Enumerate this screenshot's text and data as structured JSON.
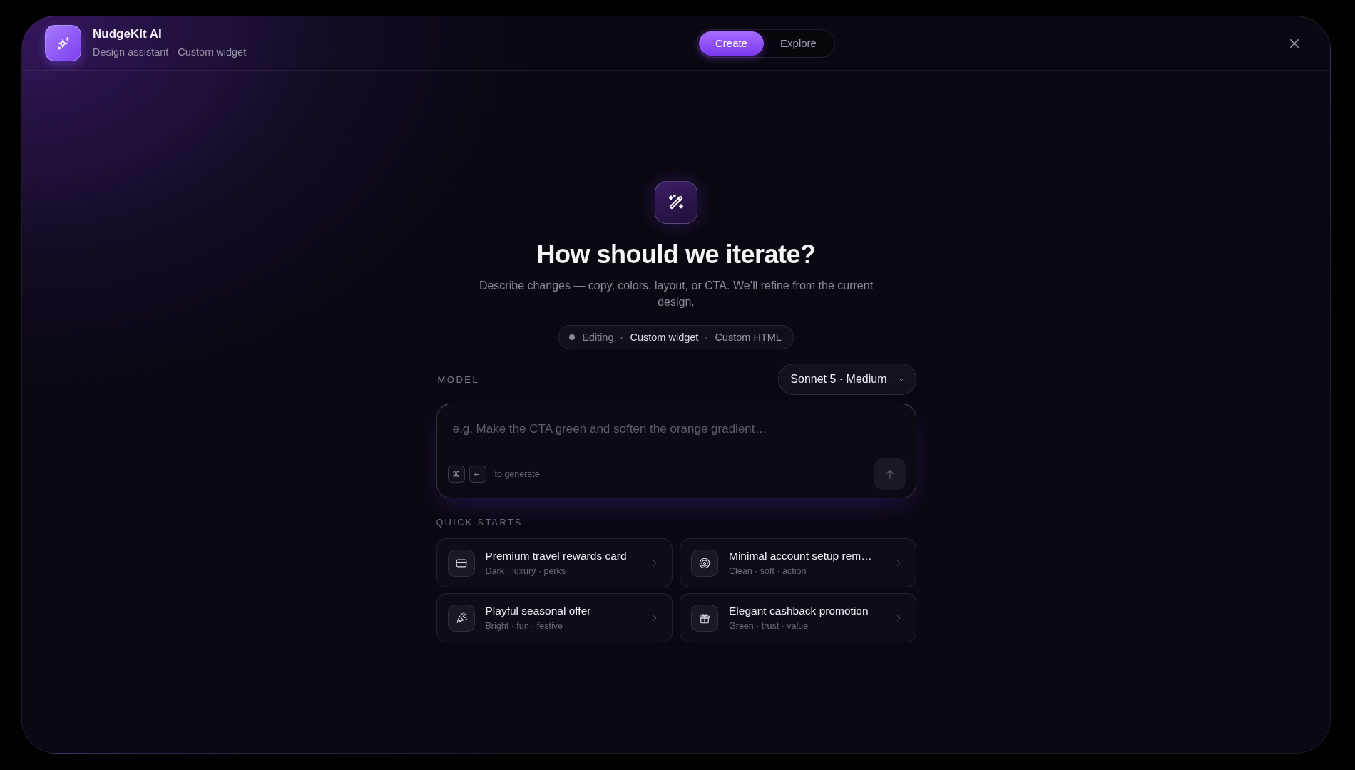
{
  "header": {
    "brand": {
      "title": "NudgeKit AI",
      "subtitle": "Design assistant · Custom widget"
    },
    "tabs": [
      {
        "label": "Create",
        "selected": true
      },
      {
        "label": "Explore",
        "selected": false
      }
    ]
  },
  "hero": {
    "title": "How should we iterate?",
    "description": "Describe changes — copy, colors, layout, or CTA. We’ll refine from the current design."
  },
  "context_chip": {
    "status": "Editing",
    "widget": "Custom widget",
    "format": "Custom HTML"
  },
  "model": {
    "label": "MODEL",
    "value": "Sonnet 5 · Medium"
  },
  "composer": {
    "placeholder": "e.g. Make the CTA green and soften the orange gradient…",
    "shortcut_keys": [
      "⌘",
      "↵"
    ],
    "shortcut_hint": "to generate",
    "send_button": {
      "disabled": true
    }
  },
  "quick_starts": {
    "label": "QUICK STARTS",
    "items": [
      {
        "title": "Premium travel rewards card",
        "tags": "Dark · luxury · perks"
      },
      {
        "title": "Minimal account setup rem…",
        "tags": "Clean · soft · action"
      },
      {
        "title": "Playful seasonal offer",
        "tags": "Bright · fun · festive"
      },
      {
        "title": "Elegant cashback promotion",
        "tags": "Green · trust · value"
      }
    ]
  }
}
